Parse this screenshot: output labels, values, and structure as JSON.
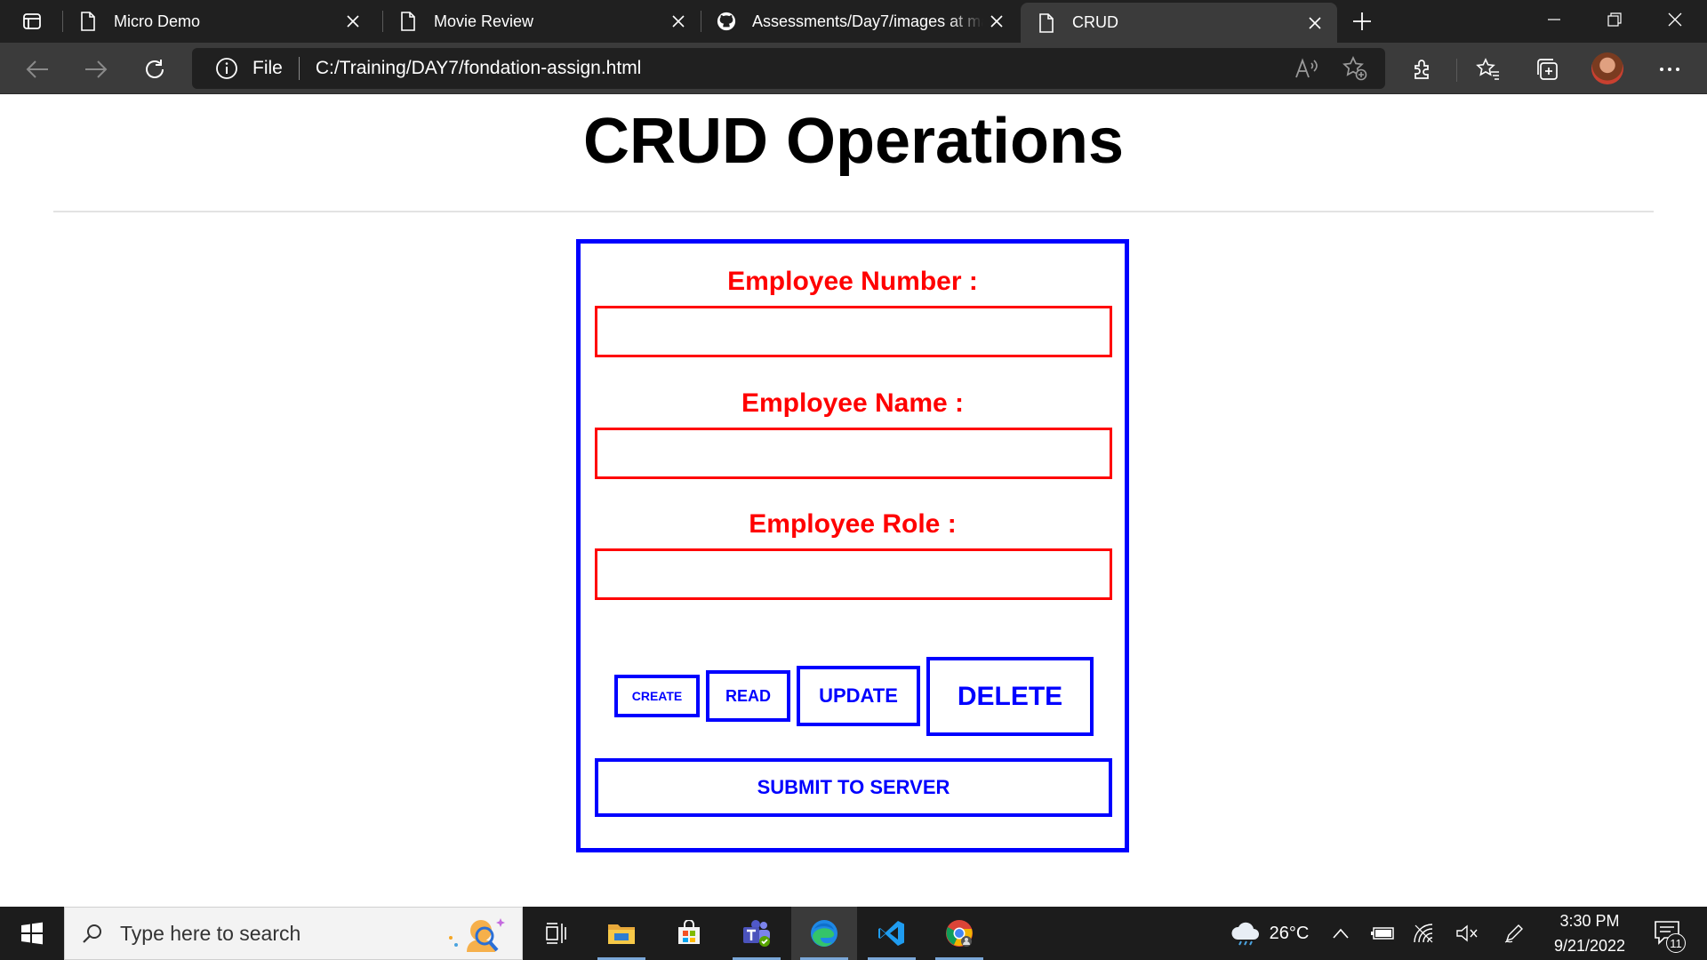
{
  "browser": {
    "tabs": [
      {
        "title": "Micro Demo",
        "icon": "page-icon",
        "active": false
      },
      {
        "title": "Movie Review",
        "icon": "page-icon",
        "active": false
      },
      {
        "title": "Assessments/Day7/images at ma",
        "icon": "github-icon",
        "active": false
      },
      {
        "title": "CRUD",
        "icon": "page-icon",
        "active": true
      }
    ],
    "address": {
      "scheme_label": "File",
      "url": "C:/Training/DAY7/fondation-assign.html"
    }
  },
  "page": {
    "title": "CRUD Operations",
    "fields": [
      {
        "label": "Employee Number :",
        "value": ""
      },
      {
        "label": "Employee Name :",
        "value": ""
      },
      {
        "label": "Employee Role :",
        "value": ""
      }
    ],
    "buttons": {
      "create": "CREATE",
      "read": "READ",
      "update": "UPDATE",
      "delete": "DELETE",
      "submit": "SUBMIT TO SERVER"
    }
  },
  "taskbar": {
    "search_placeholder": "Type here to search",
    "weather": "26°C",
    "time": "3:30 PM",
    "date": "9/21/2022",
    "notification_count": "11",
    "apps": [
      "task-view-icon",
      "file-explorer-icon",
      "microsoft-store-icon",
      "teams-icon",
      "edge-icon",
      "vscode-icon",
      "chrome-icon"
    ]
  },
  "colors": {
    "label_red": "#ff0000",
    "button_blue": "#0000ff",
    "tabbar_bg": "#202020",
    "toolbar_bg": "#3b3b3b",
    "taskbar_bg": "#1c1c1c"
  }
}
